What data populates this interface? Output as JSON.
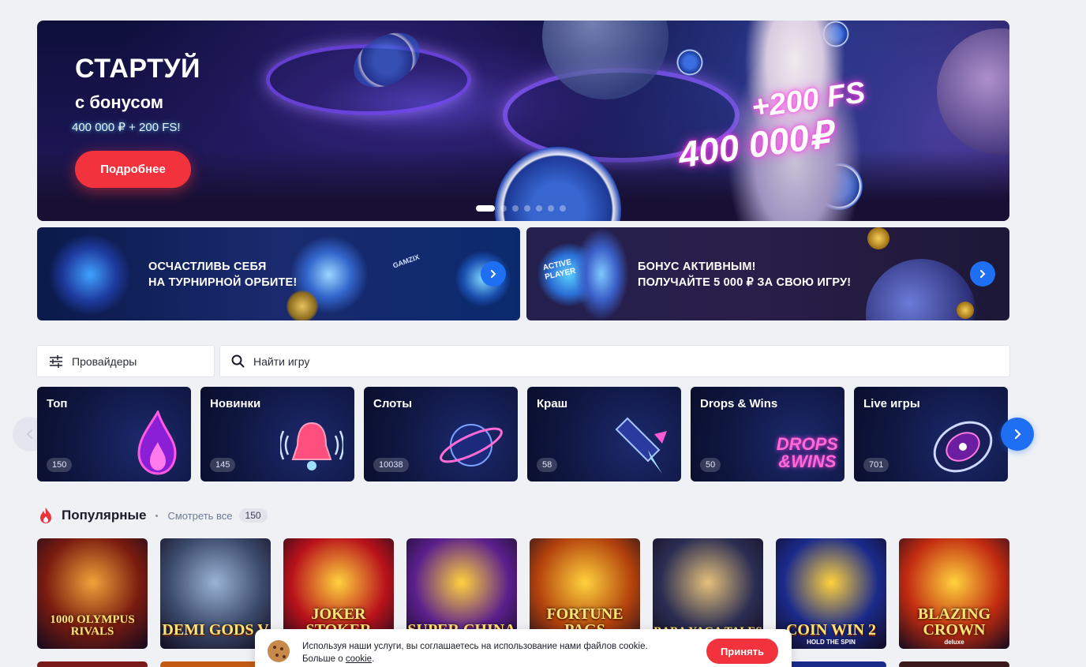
{
  "hero": {
    "title": "СТАРТУЙ",
    "subtitle": "с бонусом",
    "bonus": "400 000 ₽ + 200 FS!",
    "button": "Подробнее",
    "promo_fs": "+200 FS",
    "promo_amount": "400 000₽",
    "slides_total": 8,
    "active_slide": 1
  },
  "banners": [
    {
      "line1": "ОСЧАСТЛИВЬ СЕБЯ",
      "line2": "НА ТУРНИРНОЙ ОРБИТЕ!",
      "badge": "GAMZIX"
    },
    {
      "line1": "БОНУС АКТИВНЫМ!",
      "line2": "ПОЛУЧАЙТЕ 5 000 ₽ ЗА СВОЮ ИГРУ!",
      "badge_line1": "ACTIVE",
      "badge_line2": "PLAYER"
    }
  ],
  "filters": {
    "providers_label": "Провайдеры",
    "search_placeholder": "Найти игру"
  },
  "categories": [
    {
      "name": "Топ",
      "count": "150",
      "icon": "flame-icon"
    },
    {
      "name": "Новинки",
      "count": "145",
      "icon": "bell-icon"
    },
    {
      "name": "Слоты",
      "count": "10038",
      "icon": "planet-icon"
    },
    {
      "name": "Краш",
      "count": "58",
      "icon": "rocket-icon"
    },
    {
      "name": "Drops & Wins",
      "count": "50",
      "icon": "drops-wins-icon",
      "logo_line1": "DROPS",
      "logo_line2": "&WINS"
    },
    {
      "name": "Live игры",
      "count": "701",
      "icon": "roulette-icon"
    }
  ],
  "popular": {
    "title": "Популярные",
    "view_all": "Смотреть все",
    "count": "150",
    "games": [
      {
        "title": "1000 OLYMPUS RIVALS",
        "bg": "#7a1b0f"
      },
      {
        "title": "DEMI GODS V",
        "bg": "#3b4a6b"
      },
      {
        "title": "JOKER STOKER",
        "bg": "#b8121a"
      },
      {
        "title": "SUPER CHINA",
        "bg": "#5b1f8c"
      },
      {
        "title": "FORTUNE PAGS",
        "bg": "#b3420c"
      },
      {
        "title": "BABA YAGA TALES",
        "bg": "#2a2d52"
      },
      {
        "title": "COIN WIN 2",
        "sub": "HOLD THE SPIN",
        "bg": "#1a2a8a"
      },
      {
        "title": "BLAZING CROWN",
        "sub": "deluxe",
        "bg": "#c22b10"
      }
    ]
  },
  "cookie": {
    "text": "Используя наши услуги, вы соглашаетесь на использование нами файлов cookie.",
    "more_prefix": "Больше о",
    "link": "cookie",
    "button": "Принять"
  },
  "colors": {
    "accent_red": "#f2333e",
    "accent_blue": "#1f6ff2",
    "page_bg": "#eff1f5"
  }
}
